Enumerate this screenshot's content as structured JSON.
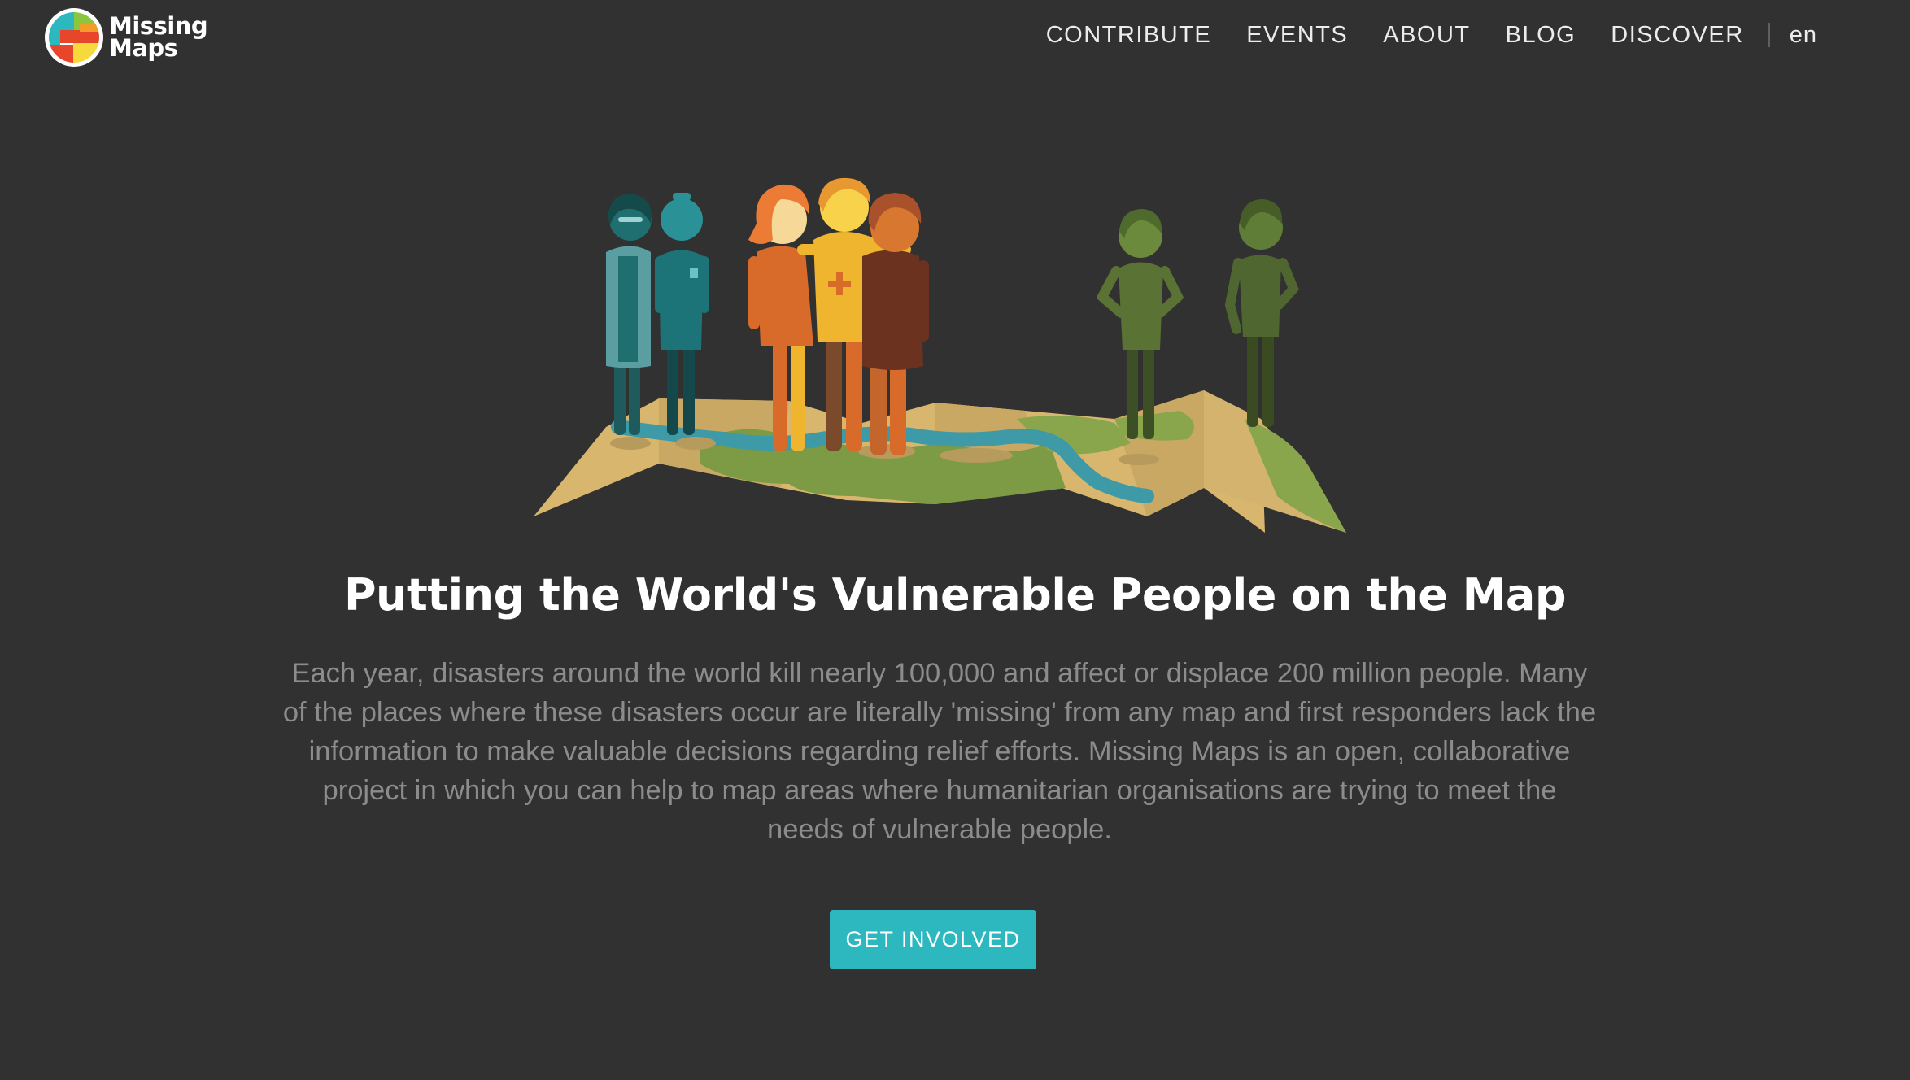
{
  "header": {
    "logo": {
      "line1": "Missing",
      "line2": "Maps",
      "icon": "missing-maps-logo-icon"
    },
    "nav": [
      {
        "label": "CONTRIBUTE"
      },
      {
        "label": "EVENTS"
      },
      {
        "label": "ABOUT"
      },
      {
        "label": "BLOG"
      },
      {
        "label": "DISCOVER"
      }
    ],
    "language": "en"
  },
  "hero": {
    "illustration": "people-standing-on-folded-map-illustration",
    "title": "Putting the World's Vulnerable People on the Map",
    "description": "Each year, disasters around the world kill nearly 100,000 and affect or displace 200 million people. Many of the places where these disasters occur are literally 'missing' from any map and first responders lack the information to make valuable decisions regarding relief efforts. Missing Maps is an open, collaborative project in which you can help to map areas where humanitarian organisations are trying to meet the needs of vulnerable people.",
    "cta_label": "GET INVOLVED"
  },
  "colors": {
    "background": "#313131",
    "accent": "#2db8c0",
    "text_primary": "#ffffff",
    "text_muted": "#8c8c8c"
  }
}
